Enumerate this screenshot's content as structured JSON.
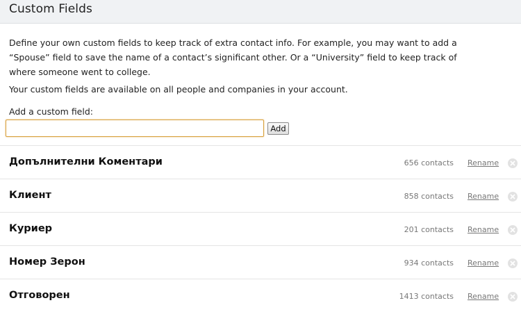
{
  "header": {
    "title": "Custom Fields"
  },
  "intro": {
    "paragraph1": "Define your own custom fields to keep track of extra contact info. For example, you may want to add a “Spouse” field to save the name of a contact’s significant other. Or a “University” field to keep track of where someone went to college.",
    "paragraph2": "Your custom fields are available on all people and companies in your account."
  },
  "add_field": {
    "label": "Add a custom field:",
    "input_value": "",
    "button_label": "Add"
  },
  "fields": [
    {
      "name": "Допълнителни Коментари",
      "count": "656 contacts",
      "rename_label": "Rename",
      "delete_icon": "close-circle-icon"
    },
    {
      "name": "Клиент",
      "count": "858 contacts",
      "rename_label": "Rename",
      "delete_icon": "close-circle-icon"
    },
    {
      "name": "Куриер",
      "count": "201 contacts",
      "rename_label": "Rename",
      "delete_icon": "close-circle-icon"
    },
    {
      "name": "Номер Зерон",
      "count": "934 contacts",
      "rename_label": "Rename",
      "delete_icon": "close-circle-icon"
    },
    {
      "name": "Отговорен",
      "count": "1413 contacts",
      "rename_label": "Rename",
      "delete_icon": "close-circle-icon"
    }
  ]
}
